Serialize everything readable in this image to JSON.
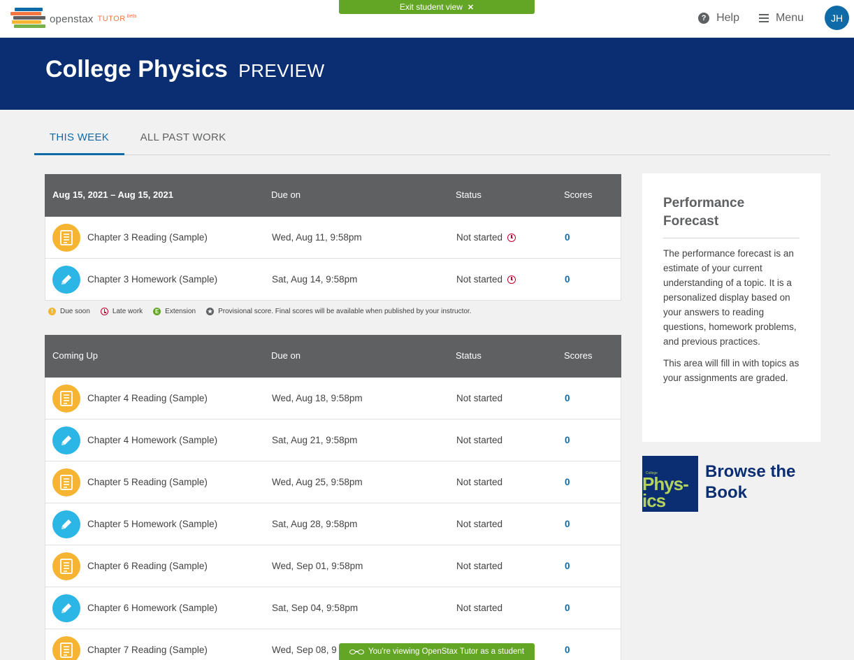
{
  "nav": {
    "logo_openstax": "openstax",
    "logo_tutor": "TUTOR",
    "logo_beta": "beta",
    "exit_label": "Exit student view",
    "exit_icon": "close-icon",
    "help_label": "Help",
    "menu_label": "Menu",
    "avatar_initials": "JH"
  },
  "banner": {
    "title": "College Physics",
    "badge": "PREVIEW",
    "color": "#0a2e71"
  },
  "tabs": [
    {
      "label": "THIS WEEK",
      "active": true
    },
    {
      "label": "ALL PAST WORK",
      "active": false
    }
  ],
  "this_week": {
    "headers": [
      "Aug 15, 2021 – Aug 15, 2021",
      "Due on",
      "Status",
      "Scores"
    ],
    "rows": [
      {
        "type": "reading",
        "title": "Chapter 3 Reading (Sample)",
        "due": "Wed, Aug 11, 9:58pm",
        "status": "Not started",
        "late": true,
        "score": "0"
      },
      {
        "type": "homework",
        "title": "Chapter 3 Homework (Sample)",
        "due": "Sat, Aug 14, 9:58pm",
        "status": "Not started",
        "late": true,
        "score": "0"
      }
    ]
  },
  "legend": {
    "due_soon": "Due soon",
    "late_work": "Late work",
    "extension": "Extension",
    "extension_letter": "E",
    "provisional": "Provisional score. Final scores will be available when published by your instructor."
  },
  "coming_up": {
    "headers": [
      "Coming Up",
      "Due on",
      "Status",
      "Scores"
    ],
    "rows": [
      {
        "type": "reading",
        "title": "Chapter 4 Reading (Sample)",
        "due": "Wed, Aug 18, 9:58pm",
        "status": "Not started",
        "score": "0"
      },
      {
        "type": "homework",
        "title": "Chapter 4 Homework (Sample)",
        "due": "Sat, Aug 21, 9:58pm",
        "status": "Not started",
        "score": "0"
      },
      {
        "type": "reading",
        "title": "Chapter 5 Reading (Sample)",
        "due": "Wed, Aug 25, 9:58pm",
        "status": "Not started",
        "score": "0"
      },
      {
        "type": "homework",
        "title": "Chapter 5 Homework (Sample)",
        "due": "Sat, Aug 28, 9:58pm",
        "status": "Not started",
        "score": "0"
      },
      {
        "type": "reading",
        "title": "Chapter 6 Reading (Sample)",
        "due": "Wed, Sep 01, 9:58pm",
        "status": "Not started",
        "score": "0"
      },
      {
        "type": "homework",
        "title": "Chapter 6 Homework (Sample)",
        "due": "Sat, Sep 04, 9:58pm",
        "status": "Not started",
        "score": "0"
      },
      {
        "type": "reading",
        "title": "Chapter 7 Reading (Sample)",
        "due": "Wed, Sep 08, 9",
        "status": "",
        "score": "0"
      }
    ]
  },
  "forecast": {
    "title": "Performance Forecast",
    "para1": "The performance forecast is an estimate of your current understanding of a topic. It is a personalized display based on your answers to reading questions, homework problems, and previous practices.",
    "para2": "This area will fill in with topics as your assignments are graded."
  },
  "browse": {
    "label": "Browse the Book",
    "cover_small": "College",
    "cover_line1": "Phys-",
    "cover_line2": "ics"
  },
  "student_bar": {
    "label": "You're viewing OpenStax Tutor as a student",
    "icon": "glasses-icon"
  },
  "colors": {
    "reading": "#f5b533",
    "homework": "#2cb6e5",
    "late": "#c2002f",
    "accent": "#0e6ba8",
    "green": "#63a524"
  }
}
